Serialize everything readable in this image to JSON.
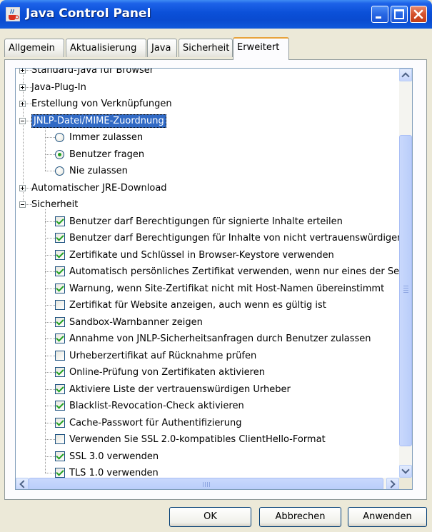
{
  "window": {
    "title": "Java Control Panel"
  },
  "tabs": [
    {
      "label": "Allgemein"
    },
    {
      "label": "Aktualisierung"
    },
    {
      "label": "Java"
    },
    {
      "label": "Sicherheit"
    },
    {
      "label": "Erweitert",
      "active": true
    }
  ],
  "tree": {
    "nodes": [
      {
        "label": "Standard-Java für Browser",
        "type": "folder",
        "expanded": false
      },
      {
        "label": "Java-Plug-In",
        "type": "folder",
        "expanded": false
      },
      {
        "label": "Erstellung von Verknüpfungen",
        "type": "folder",
        "expanded": false
      },
      {
        "label": "JNLP-Datei/MIME-Zuordnung",
        "type": "folder",
        "expanded": true,
        "selected": true
      },
      {
        "label": "Immer zulassen",
        "type": "radio",
        "checked": false
      },
      {
        "label": "Benutzer fragen",
        "type": "radio",
        "checked": true
      },
      {
        "label": "Nie zulassen",
        "type": "radio",
        "checked": false
      },
      {
        "label": "Automatischer JRE-Download",
        "type": "folder",
        "expanded": false
      },
      {
        "label": "Sicherheit",
        "type": "folder",
        "expanded": true
      },
      {
        "label": "Benutzer darf Berechtigungen für signierte Inhalte erteilen",
        "type": "checkbox",
        "checked": true
      },
      {
        "label": "Benutzer darf Berechtigungen für Inhalte von nicht vertrauenswürdigen",
        "type": "checkbox",
        "checked": true
      },
      {
        "label": "Zertifikate und Schlüssel in Browser-Keystore verwenden",
        "type": "checkbox",
        "checked": true
      },
      {
        "label": "Automatisch persönliches Zertifikat verwenden, wenn nur eines der Serv",
        "type": "checkbox",
        "checked": true
      },
      {
        "label": "Warnung, wenn Site-Zertifikat nicht mit Host-Namen übereinstimmt",
        "type": "checkbox",
        "checked": true
      },
      {
        "label": "Zertifikat für Website anzeigen, auch wenn es gültig ist",
        "type": "checkbox",
        "checked": false
      },
      {
        "label": "Sandbox-Warnbanner zeigen",
        "type": "checkbox",
        "checked": true
      },
      {
        "label": "Annahme von JNLP-Sicherheitsanfragen durch Benutzer zulassen",
        "type": "checkbox",
        "checked": true
      },
      {
        "label": "Urheberzertifikat auf Rücknahme prüfen",
        "type": "checkbox",
        "checked": false
      },
      {
        "label": "Online-Prüfung von Zertifikaten aktivieren",
        "type": "checkbox",
        "checked": true
      },
      {
        "label": "Aktiviere Liste der vertrauenswürdigen Urheber",
        "type": "checkbox",
        "checked": true
      },
      {
        "label": "Blacklist-Revocation-Check aktivieren",
        "type": "checkbox",
        "checked": true
      },
      {
        "label": "Cache-Passwort für Authentifizierung",
        "type": "checkbox",
        "checked": true
      },
      {
        "label": "Verwenden Sie SSL 2.0-kompatibles ClientHello-Format",
        "type": "checkbox",
        "checked": false
      },
      {
        "label": "SSL 3.0 verwenden",
        "type": "checkbox",
        "checked": true
      },
      {
        "label": "TLS 1.0 verwenden",
        "type": "checkbox",
        "checked": true
      }
    ]
  },
  "buttons": {
    "ok": "OK",
    "cancel": "Abbrechen",
    "apply": "Anwenden"
  },
  "icons": {
    "title": "java-cup-icon",
    "minimize": "minimize-icon",
    "maximize": "maximize-icon",
    "close": "close-icon",
    "scroll_up": "arrow-up-icon",
    "scroll_down": "arrow-down-icon",
    "scroll_left": "arrow-left-icon",
    "scroll_right": "arrow-right-icon"
  },
  "colors": {
    "titlebar": "#0a4bd0",
    "selection": "#316ac5",
    "check": "#21a121",
    "active_tab_accent": "#e8a33c"
  }
}
